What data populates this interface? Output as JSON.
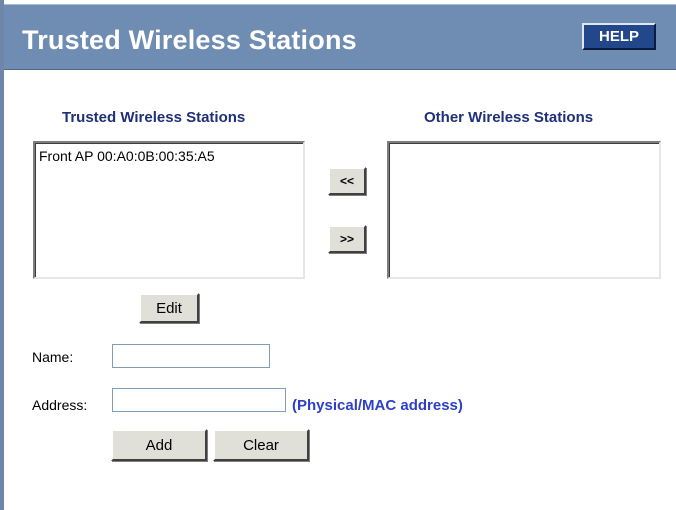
{
  "header": {
    "title": "Trusted Wireless Stations",
    "help_label": "HELP"
  },
  "trusted": {
    "heading": "Trusted Wireless Stations",
    "items": [
      "Front AP 00:A0:0B:00:35:A5"
    ]
  },
  "other": {
    "heading": "Other Wireless Stations",
    "items": []
  },
  "transfer": {
    "move_left_label": "<<",
    "move_right_label": ">>"
  },
  "edit_label": "Edit",
  "form": {
    "name_label": "Name:",
    "name_value": "",
    "address_label": "Address:",
    "address_value": "",
    "address_hint": "(Physical/MAC address)",
    "add_label": "Add",
    "clear_label": "Clear"
  }
}
